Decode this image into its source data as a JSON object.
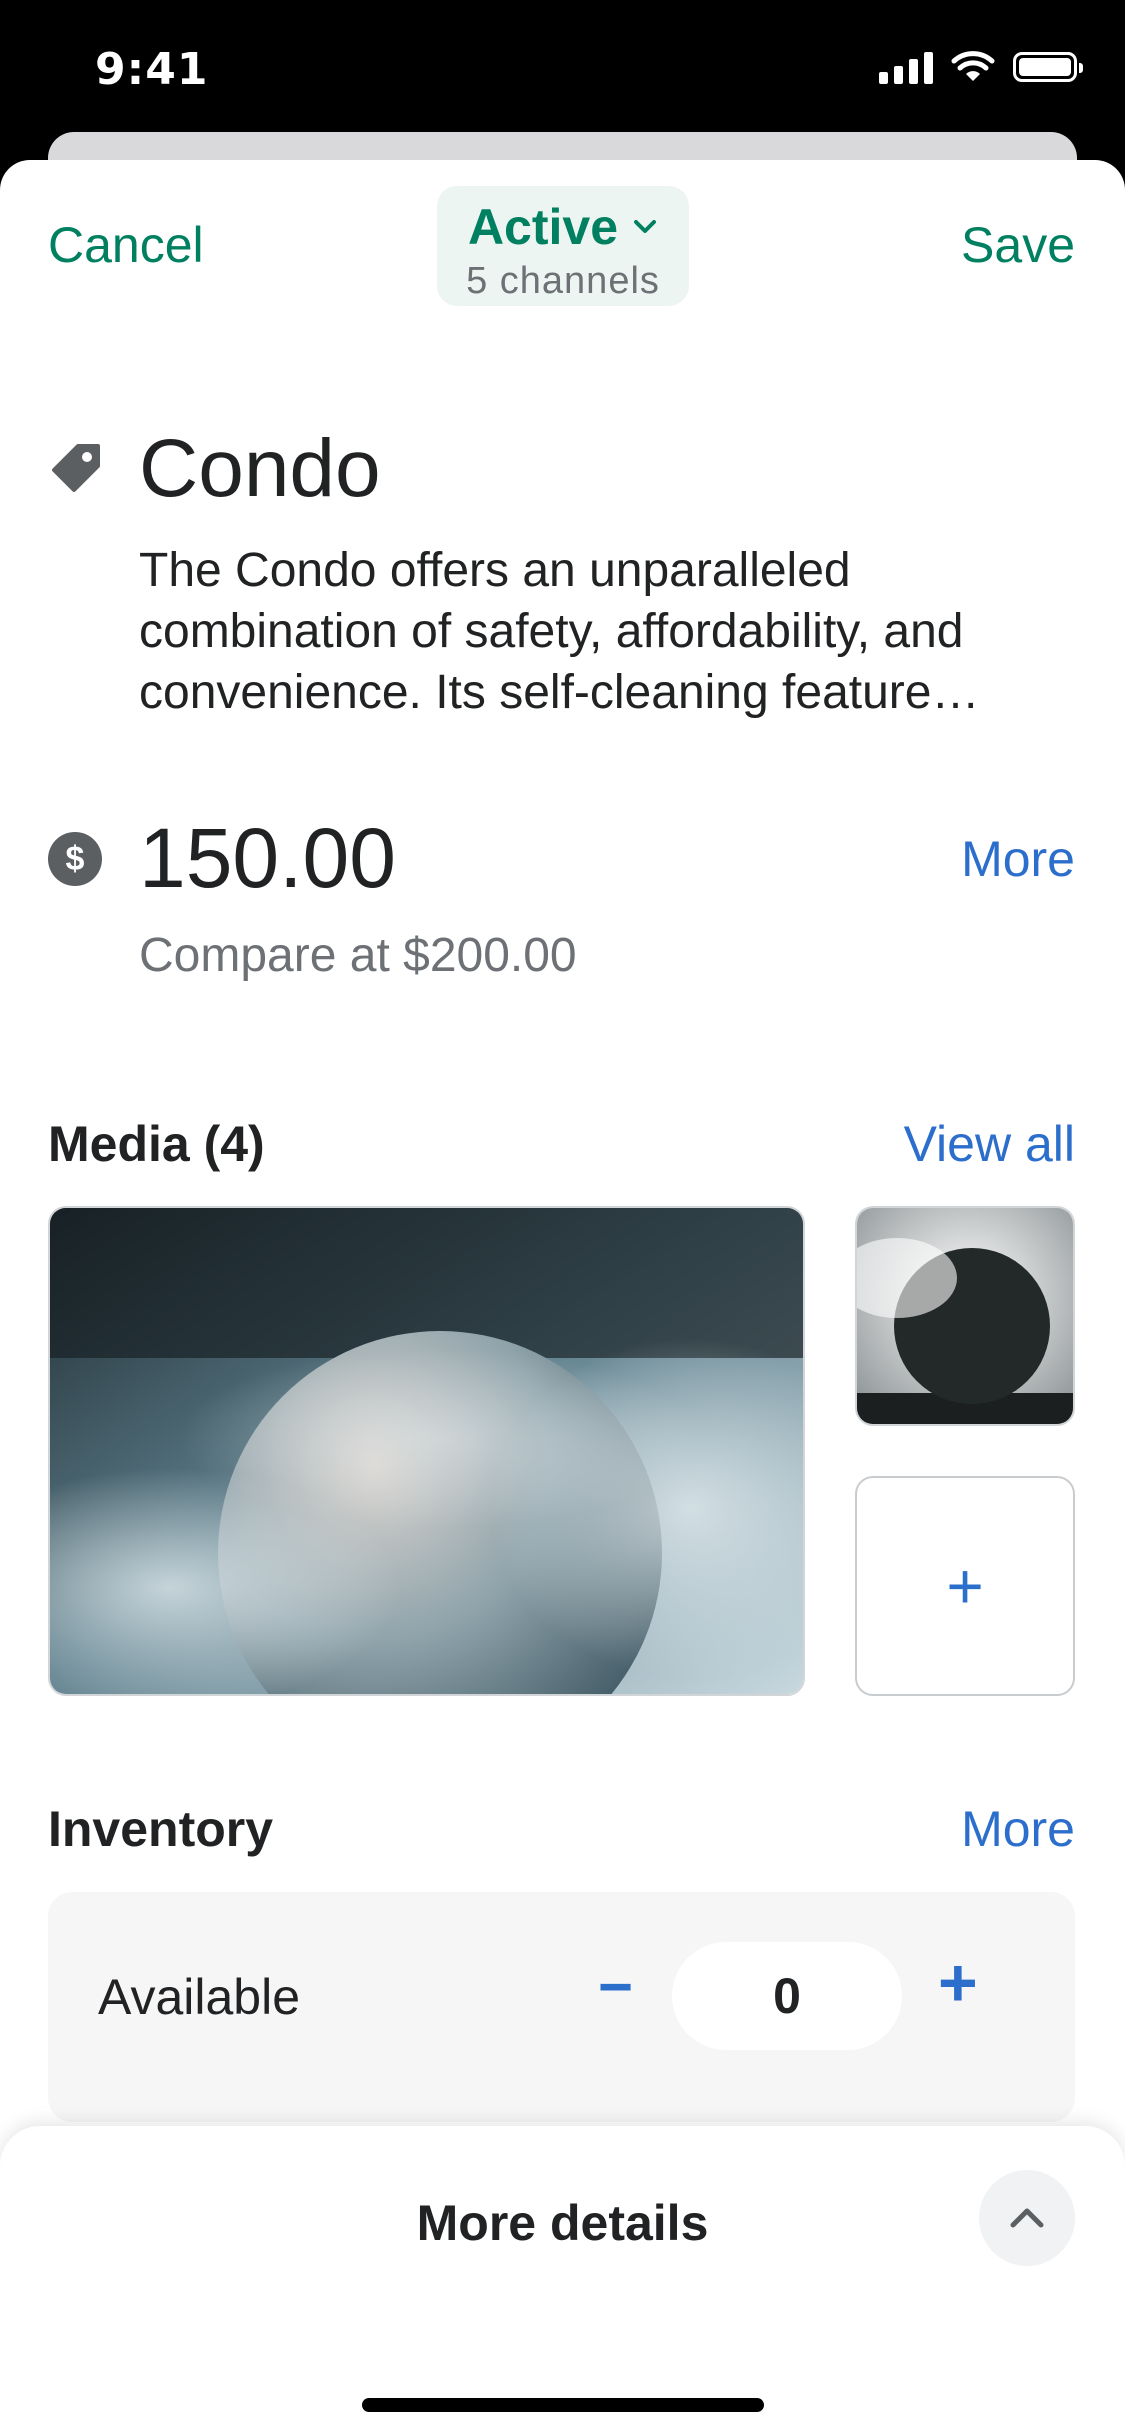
{
  "status_bar": {
    "time": "9:41"
  },
  "nav": {
    "cancel": "Cancel",
    "save": "Save",
    "status": "Active",
    "channels": "5 channels"
  },
  "product": {
    "title": "Condo",
    "description": "The Condo offers an unparalleled combination of safety, affordability, and convenience. Its self-cleaning feature…",
    "price": "150.00",
    "compare_at": "Compare at $200.00",
    "price_more": "More"
  },
  "media": {
    "title": "Media (4)",
    "view_all": "View all",
    "add_symbol": "+"
  },
  "inventory": {
    "title": "Inventory",
    "more": "More",
    "available_label": "Available",
    "quantity": "0",
    "decrement": "−",
    "increment": "+"
  },
  "bottom_sheet": {
    "title": "More details"
  },
  "icons": [
    "tag-icon",
    "dollar-icon",
    "chevron-down-icon",
    "chevron-up-icon",
    "signal-icon",
    "wifi-icon",
    "battery-icon"
  ],
  "colors": {
    "brand_green": "#008060",
    "link_blue": "#2c6ecb",
    "pill_bg": "#edf5f2"
  }
}
